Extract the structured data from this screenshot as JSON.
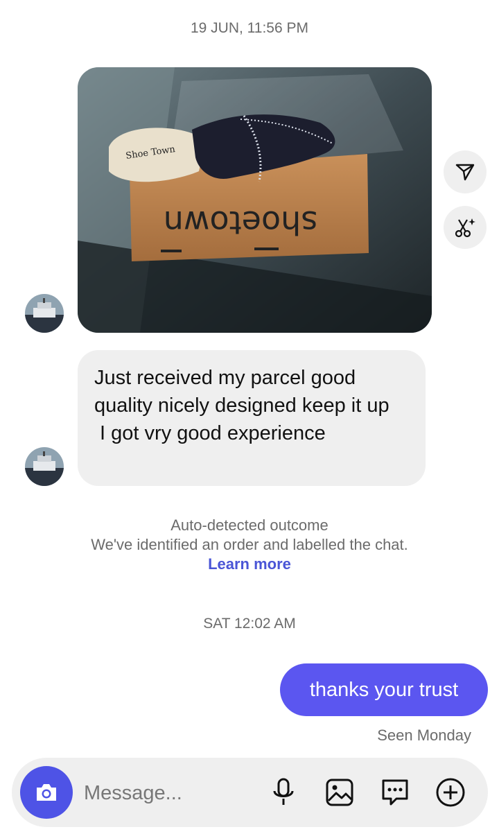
{
  "thread": {
    "timestamp_1": "19 JUN, 11:56 PM",
    "received_message": {
      "line1": "Just received my parcel good quality nicely designed keep it up",
      "line2": " I got vry good experience"
    },
    "photo_box_brand": "shoetown",
    "photo_insole_brand": "Shoe Town",
    "notice": {
      "title": "Auto-detected outcome",
      "body": "We've identified an order and labelled the chat.",
      "link": "Learn more"
    },
    "timestamp_2": "SAT 12:02 AM",
    "sent_message": "thanks your trust",
    "seen_status": "Seen Monday"
  },
  "composer": {
    "placeholder": "Message...",
    "accent_color": "#4e53e6"
  },
  "icons": {
    "share": "paper-plane-icon",
    "ai_edit": "scissors-sparkle-icon",
    "camera": "camera-icon",
    "mic": "microphone-icon",
    "gallery": "image-icon",
    "sticker": "chat-bubble-icon",
    "more": "plus-circle-icon"
  }
}
